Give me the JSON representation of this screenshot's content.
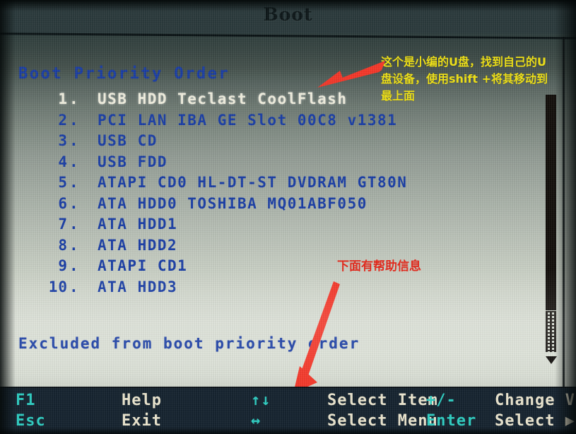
{
  "screen": {
    "title": "Boot",
    "section_heading": "Boot Priority Order",
    "excluded_heading": "Excluded from boot priority order"
  },
  "boot_order": [
    {
      "index": "1",
      "dot": ".",
      "device": "USB HDD Teclast CoolFlash",
      "selected": true
    },
    {
      "index": "2",
      "dot": ".",
      "device": "PCI LAN IBA GE Slot 00C8 v1381",
      "selected": false
    },
    {
      "index": "3",
      "dot": ".",
      "device": "USB CD",
      "selected": false
    },
    {
      "index": "4",
      "dot": ".",
      "device": "USB FDD",
      "selected": false
    },
    {
      "index": "5",
      "dot": ".",
      "device": "ATAPI CD0 HL-DT-ST DVDRAM GT80N",
      "selected": false
    },
    {
      "index": "6",
      "dot": ".",
      "device": "ATA HDD0 TOSHIBA MQ01ABF050",
      "selected": false
    },
    {
      "index": "7",
      "dot": ".",
      "device": "ATA HDD1",
      "selected": false
    },
    {
      "index": "8",
      "dot": ".",
      "device": "ATA HDD2",
      "selected": false
    },
    {
      "index": "9",
      "dot": ".",
      "device": "ATAPI CD1",
      "selected": false
    },
    {
      "index": "10",
      "dot": ".",
      "device": "ATA HDD3",
      "selected": false
    }
  ],
  "annotations": {
    "usb_note_line1": "这个是小编的U盘，找到自己的U",
    "usb_note_line2": "盘设备，使用shift +将其移动到",
    "usb_note_line3": "最上面",
    "help_note": "下面有帮助信息"
  },
  "function_bar": {
    "row1": [
      {
        "key": "F1",
        "label": "Help"
      },
      {
        "key": "↑↓",
        "label": "Select Item"
      },
      {
        "key": "+/-",
        "label": "Change Values"
      }
    ],
    "row2": [
      {
        "key": "Esc",
        "label": "Exit"
      },
      {
        "key": "↔",
        "label": "Select Menu"
      },
      {
        "key": "Enter",
        "label": "Select ▶ Sub-Menu"
      }
    ],
    "f1_key": "F1",
    "f1_label": "Help",
    "updown_key": "↑↓",
    "updown_label": "Select Item",
    "plusminus_key": "+/-",
    "plusminus_label": "Change Values",
    "esc_key": "Esc",
    "esc_label": "Exit",
    "leftright_key": "↔",
    "leftright_label": "Select Menu",
    "enter_key": "Enter",
    "enter_label": "Select ▶ Sub-Menu"
  },
  "scrollbar": {
    "down_arrow": "down-arrow"
  },
  "colors": {
    "bios_text_blue": "#1b3fa8",
    "selected_text": "#f4f2e2",
    "annotation_yellow": "#f5e616",
    "annotation_red": "#e8291c",
    "fn_key_cyan": "#2fd0c4",
    "fn_label_cream": "#efe9d2",
    "fn_bar_background": "#162430"
  }
}
